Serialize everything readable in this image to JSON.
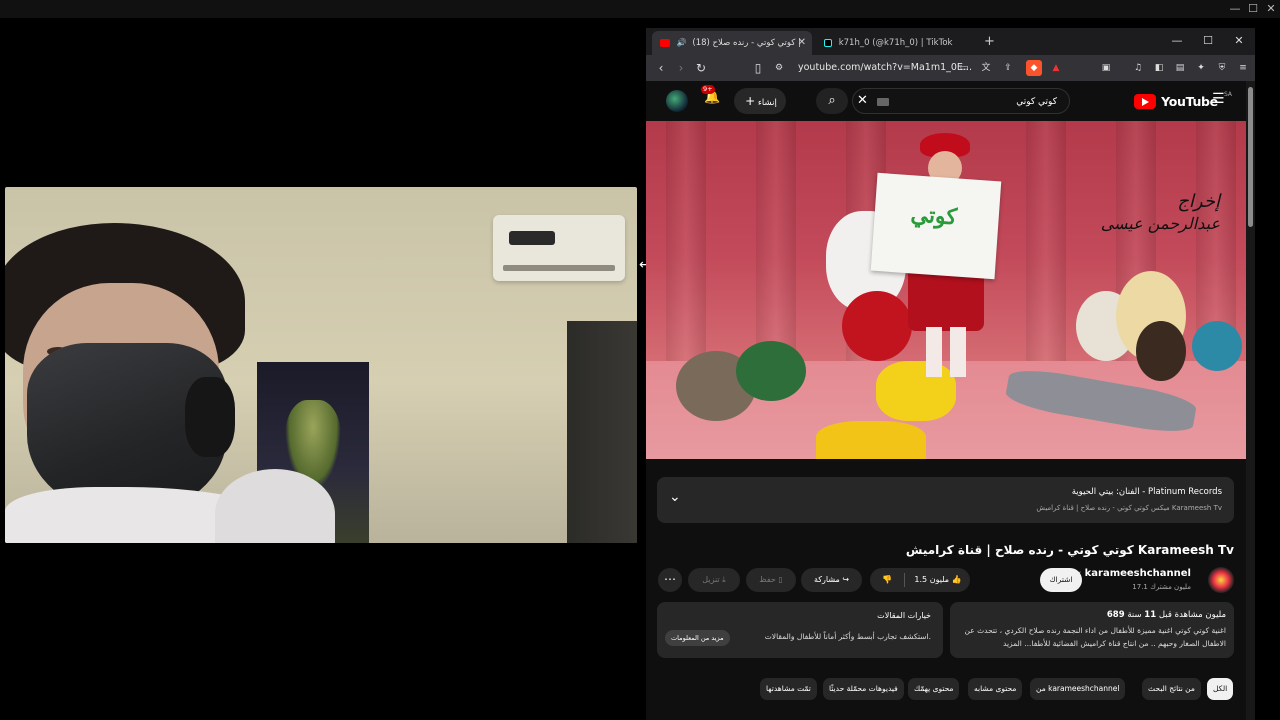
{
  "os_controls": [
    "—",
    "☐",
    "✕"
  ],
  "browser": {
    "tabs": [
      {
        "label": "(18) كوتي كوتي - رنده صلاح |",
        "active": true
      },
      {
        "label": "k71h_0 (@k71h_0) | TikTok",
        "active": false
      }
    ],
    "new_tab": "+",
    "window_controls": [
      "—",
      "☐",
      "✕"
    ],
    "url": "youtube.com/watch?v=Ma1m1_0E..."
  },
  "youtube": {
    "logo_word": "YouTube",
    "logo_region": "SA",
    "search_query": "كوتي كوتي",
    "create_label": "إنشاء",
    "notif_badge": "9+",
    "music": {
      "line1": "الفنان: بيتي الحيوية - Platinum Records",
      "line2": "ميكس كوتي كوتي - رنده صلاح | قناة كراميش Karameesh Tv"
    },
    "video_overlay": {
      "sign": "كوتي",
      "credit_line1": "إخراج",
      "credit_line2": "عبدالرحمن عيسى"
    },
    "video_title": "كوتي كوتي - رنده صلاح | قناة كراميش Karameesh Tv",
    "channel": {
      "name": "karameeshchannel",
      "subs": "17.1 مليون مشترك",
      "verified": "✔"
    },
    "actions": {
      "subscribe": "اشتراك",
      "likes": "1.5 مليون",
      "share": "مشاركة",
      "save": "حفظ",
      "download": "تنزيل",
      "more": "⋯"
    },
    "description": {
      "views": "689",
      "views_suffix": "مليون مشاهدة",
      "age_prefix": "قبل",
      "age": "11",
      "age_suffix": "سنة",
      "text": "اغنية كوتي كوتي اغنية مميزة للأطفال من اداء النجمة رنده صلاح الكردي ، تتحدث عن الاطفال الصغار وحبهم .. من انتاج قناة كراميش الفضائية للأطفا... المزيد"
    },
    "ai_box": {
      "heading": "خيارات المقالات",
      "body": "استكشف تجارب أبسط وأكثر أماناً للأطفال والمقالات.",
      "more": "مزيد من المعلومات"
    },
    "chips": [
      {
        "label": "الكل",
        "selected": true
      },
      {
        "label": "من نتائج البحث",
        "selected": false
      },
      {
        "label": "من karameeshchannel",
        "selected": false
      },
      {
        "label": "محتوى مشابه",
        "selected": false
      },
      {
        "label": "محتوى يهمّك",
        "selected": false
      },
      {
        "label": "فيديوهات محمّلة حديثًا",
        "selected": false
      },
      {
        "label": "تمّت مشاهدتها",
        "selected": false
      }
    ]
  },
  "colors": {
    "yt_bg": "#0f0f0f",
    "yt_red": "#ff0000",
    "card": "#272727",
    "curtain": "#c34a5a"
  }
}
